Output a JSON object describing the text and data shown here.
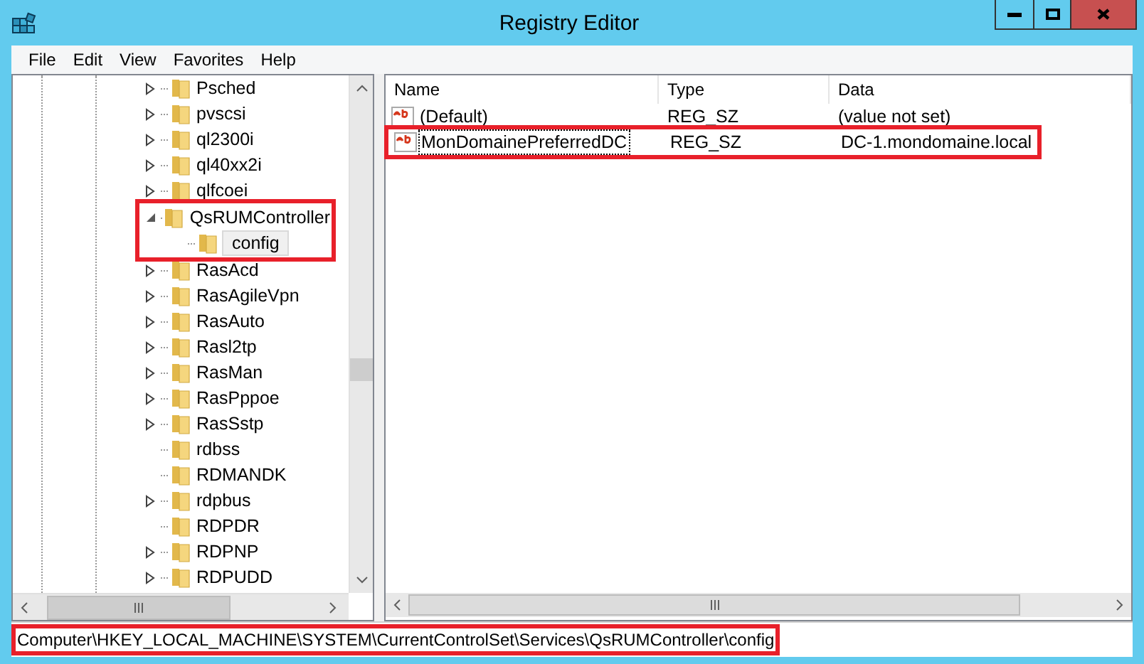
{
  "window": {
    "title": "Registry Editor"
  },
  "menu": [
    "File",
    "Edit",
    "View",
    "Favorites",
    "Help"
  ],
  "tree": [
    {
      "label": "Psched",
      "has_children": true,
      "expanded": false,
      "selected": false,
      "highlighted": false
    },
    {
      "label": "pvscsi",
      "has_children": true,
      "expanded": false,
      "selected": false,
      "highlighted": false
    },
    {
      "label": "ql2300i",
      "has_children": true,
      "expanded": false,
      "selected": false,
      "highlighted": false
    },
    {
      "label": "ql40xx2i",
      "has_children": true,
      "expanded": false,
      "selected": false,
      "highlighted": false
    },
    {
      "label": "qlfcoei",
      "has_children": true,
      "expanded": false,
      "selected": false,
      "highlighted": false
    },
    {
      "label": "QsRUMController",
      "has_children": true,
      "expanded": true,
      "selected": false,
      "highlighted": true,
      "children": [
        {
          "label": "config",
          "has_children": false,
          "selected": true,
          "highlighted": true
        }
      ]
    },
    {
      "label": "RasAcd",
      "has_children": true,
      "expanded": false,
      "selected": false,
      "highlighted": false
    },
    {
      "label": "RasAgileVpn",
      "has_children": true,
      "expanded": false,
      "selected": false,
      "highlighted": false
    },
    {
      "label": "RasAuto",
      "has_children": true,
      "expanded": false,
      "selected": false,
      "highlighted": false
    },
    {
      "label": "Rasl2tp",
      "has_children": true,
      "expanded": false,
      "selected": false,
      "highlighted": false
    },
    {
      "label": "RasMan",
      "has_children": true,
      "expanded": false,
      "selected": false,
      "highlighted": false
    },
    {
      "label": "RasPppoe",
      "has_children": true,
      "expanded": false,
      "selected": false,
      "highlighted": false
    },
    {
      "label": "RasSstp",
      "has_children": true,
      "expanded": false,
      "selected": false,
      "highlighted": false
    },
    {
      "label": "rdbss",
      "has_children": false,
      "selected": false,
      "highlighted": false
    },
    {
      "label": "RDMANDK",
      "has_children": false,
      "selected": false,
      "highlighted": false
    },
    {
      "label": "rdpbus",
      "has_children": true,
      "expanded": false,
      "selected": false,
      "highlighted": false
    },
    {
      "label": "RDPDR",
      "has_children": false,
      "selected": false,
      "highlighted": false
    },
    {
      "label": "RDPNP",
      "has_children": true,
      "expanded": false,
      "selected": false,
      "highlighted": false
    },
    {
      "label": "RDPUDD",
      "has_children": true,
      "expanded": false,
      "selected": false,
      "highlighted": false
    }
  ],
  "values": {
    "columns": [
      "Name",
      "Type",
      "Data"
    ],
    "rows": [
      {
        "name": "(Default)",
        "type": "REG_SZ",
        "data": "(value not set)",
        "focused": false,
        "highlighted": false
      },
      {
        "name": "MonDomainePreferredDC",
        "type": "REG_SZ",
        "data": "DC-1.mondomaine.local",
        "focused": true,
        "highlighted": true
      }
    ]
  },
  "status_bar": {
    "path": "Computer\\HKEY_LOCAL_MACHINE\\SYSTEM\\CurrentControlSet\\Services\\QsRUMController\\config",
    "highlighted": true
  }
}
